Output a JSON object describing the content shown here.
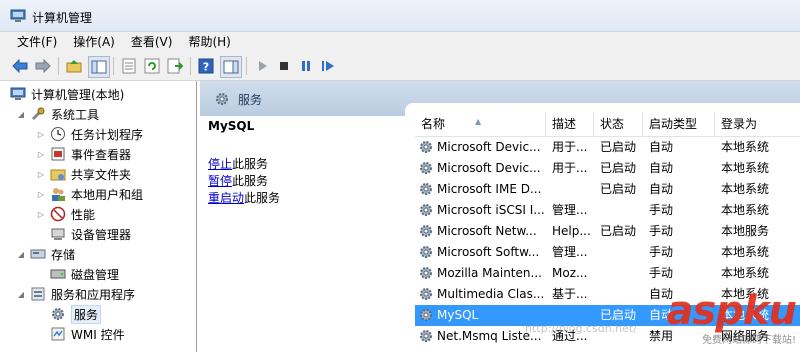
{
  "window": {
    "title": "计算机管理"
  },
  "menu": [
    {
      "label": "文件(F)"
    },
    {
      "label": "操作(A)"
    },
    {
      "label": "查看(V)"
    },
    {
      "label": "帮助(H)"
    }
  ],
  "tree": {
    "items": [
      {
        "label": "计算机管理(本地)",
        "icon": "computer-management-icon"
      },
      {
        "label": "系统工具",
        "icon": "system-tools-icon"
      },
      {
        "label": "任务计划程序",
        "icon": "clock-icon"
      },
      {
        "label": "事件查看器",
        "icon": "event-viewer-icon"
      },
      {
        "label": "共享文件夹",
        "icon": "shared-folder-icon"
      },
      {
        "label": "本地用户和组",
        "icon": "users-icon"
      },
      {
        "label": "性能",
        "icon": "performance-icon"
      },
      {
        "label": "设备管理器",
        "icon": "device-manager-icon"
      },
      {
        "label": "存储",
        "icon": "storage-icon"
      },
      {
        "label": "磁盘管理",
        "icon": "disk-icon"
      },
      {
        "label": "服务和应用程序",
        "icon": "services-apps-icon"
      },
      {
        "label": "服务",
        "icon": "gear-icon"
      },
      {
        "label": "WMI 控件",
        "icon": "wmi-icon"
      }
    ]
  },
  "panel": {
    "header": "服务",
    "service_name": "MySQL",
    "actions": [
      {
        "link": "停止",
        "rest": "此服务"
      },
      {
        "link": "暂停",
        "rest": "此服务"
      },
      {
        "link": "重启动",
        "rest": "此服务"
      }
    ]
  },
  "columns": [
    "名称",
    "描述",
    "状态",
    "启动类型",
    "登录为"
  ],
  "services": [
    {
      "name": "Microsoft Devic...",
      "desc": "用于...",
      "status": "已启动",
      "startup": "自动",
      "logon": "本地系统"
    },
    {
      "name": "Microsoft Devic...",
      "desc": "用于...",
      "status": "已启动",
      "startup": "自动",
      "logon": "本地系统"
    },
    {
      "name": "Microsoft IME D...",
      "desc": "",
      "status": "已启动",
      "startup": "自动",
      "logon": "本地系统"
    },
    {
      "name": "Microsoft iSCSI I...",
      "desc": "管理...",
      "status": "",
      "startup": "手动",
      "logon": "本地系统"
    },
    {
      "name": "Microsoft Netw...",
      "desc": "Help...",
      "status": "已启动",
      "startup": "手动",
      "logon": "本地服务"
    },
    {
      "name": "Microsoft Softw...",
      "desc": "管理...",
      "status": "",
      "startup": "手动",
      "logon": "本地系统"
    },
    {
      "name": "Mozilla Mainten...",
      "desc": "Moz...",
      "status": "",
      "startup": "手动",
      "logon": "本地系统"
    },
    {
      "name": "Multimedia Clas...",
      "desc": "基于...",
      "status": "",
      "startup": "自动",
      "logon": "本地系统"
    },
    {
      "name": "MySQL",
      "desc": "",
      "status": "已启动",
      "startup": "自动",
      "logon": "本地系统"
    },
    {
      "name": "Net.Msmq Liste...",
      "desc": "通过...",
      "status": "",
      "startup": "禁用",
      "logon": "网络服务"
    }
  ],
  "selected_row": 8,
  "colors": {
    "selection": "#3399ff",
    "header_band": "#c6d5e8",
    "link": "#0000cc",
    "watermark": "#e1301e"
  },
  "watermark": {
    "big": "aspku",
    "small": "免费网站源码下载站!",
    "url": "http://blog.csdn.net/"
  }
}
